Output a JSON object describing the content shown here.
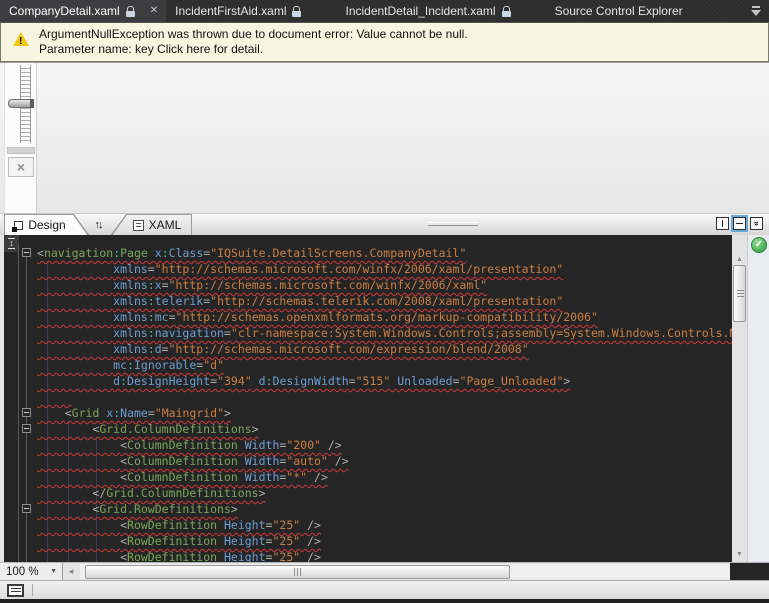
{
  "colors": {
    "editor_background": "#252526",
    "element_name": "#7CA65A",
    "attribute_name": "#6D9ED3",
    "attribute_value": "#CB7F43",
    "namespace_colon": "#3FBCA8",
    "delimiter": "#ADADAD",
    "squiggle_red": "#D03A3A",
    "warning_background": "#F7F7E1",
    "warning_icon_yellow": "#F2C811",
    "tabbar_background": "#2D2D2D",
    "active_tab_background": "#3D3D40",
    "pane_button_active_outline": "#66AADD",
    "health_indicator_green": "#2F9E3C"
  },
  "document_tabs": {
    "items": [
      {
        "label": "CompanyDetail.xaml",
        "locked": true,
        "closable": true,
        "active": true
      },
      {
        "label": "IncidentFirstAid.xaml",
        "locked": true,
        "closable": false,
        "active": false
      },
      {
        "label": "IncidentDetail_Incident.xaml",
        "locked": true,
        "closable": false,
        "active": false
      },
      {
        "label": "Source Control Explorer",
        "locked": false,
        "closable": false,
        "active": false
      }
    ],
    "overflow_icon": "tab-list-dropdown-icon"
  },
  "warning_bar": {
    "icon": "warning-triangle-icon",
    "line1": "ArgumentNullException was thrown due to document error: Value cannot be null.",
    "line2": "Parameter name: key Click here for detail."
  },
  "designer": {
    "zoom_slider_icon": "zoom-slider",
    "fit_icon_glyph": "×"
  },
  "view_tabs": {
    "design_label": "Design",
    "swap_icon_glyph": "↑↓",
    "xaml_label": "XAML",
    "pane_buttons": {
      "active": "split-horizontal",
      "collapse_glyph": "»"
    }
  },
  "editor": {
    "split_handle_glyph": "↕",
    "health_check_glyph": "✓",
    "up_arrow_glyph": "▲",
    "down_arrow_glyph": "▼",
    "lines": [
      {
        "fold": true,
        "text": "<navigation:Page x:Class=\"IQSuite.DetailScreens.CompanyDetail\""
      },
      {
        "fold": false,
        "text": "           xmlns=\"http://schemas.microsoft.com/winfx/2006/xaml/presentation\""
      },
      {
        "fold": false,
        "text": "           xmlns:x=\"http://schemas.microsoft.com/winfx/2006/xaml\""
      },
      {
        "fold": false,
        "text": "           xmlns:telerik=\"http://schemas.telerik.com/2008/xaml/presentation\""
      },
      {
        "fold": false,
        "text": "           xmlns:mc=\"http://schemas.openxmlformats.org/markup-compatibility/2006\""
      },
      {
        "fold": false,
        "text": "           xmlns:navigation=\"clr-namespace:System.Windows.Controls;assembly=System.Windows.Controls.Navigat"
      },
      {
        "fold": false,
        "text": "           xmlns:d=\"http://schemas.microsoft.com/expression/blend/2008\""
      },
      {
        "fold": false,
        "text": "           mc:Ignorable=\"d\""
      },
      {
        "fold": false,
        "text": "           d:DesignHeight=\"394\" d:DesignWidth=\"515\" Unloaded=\"Page_Unloaded\">"
      },
      {
        "fold": false,
        "text": "     "
      },
      {
        "fold": true,
        "text": "    <Grid x:Name=\"Maingrid\">"
      },
      {
        "fold": true,
        "text": "        <Grid.ColumnDefinitions>"
      },
      {
        "fold": false,
        "text": "            <ColumnDefinition Width=\"200\" />"
      },
      {
        "fold": false,
        "text": "            <ColumnDefinition Width=\"auto\" />"
      },
      {
        "fold": false,
        "text": "            <ColumnDefinition Width=\"*\" />"
      },
      {
        "fold": false,
        "text": "        </Grid.ColumnDefinitions>"
      },
      {
        "fold": true,
        "text": "        <Grid.RowDefinitions>"
      },
      {
        "fold": false,
        "text": "            <RowDefinition Height=\"25\" />"
      },
      {
        "fold": false,
        "text": "            <RowDefinition Height=\"25\" />"
      },
      {
        "fold": false,
        "text": "            <RowDefinition Height=\"25\" />"
      }
    ]
  },
  "hscrollbar": {
    "zoom_value": "100 %",
    "left_arrow_glyph": "◄",
    "right_arrow_glyph": "►",
    "dropdown_glyph": "▼"
  },
  "bottom_bar": {
    "icon": "output-panel-icon"
  }
}
